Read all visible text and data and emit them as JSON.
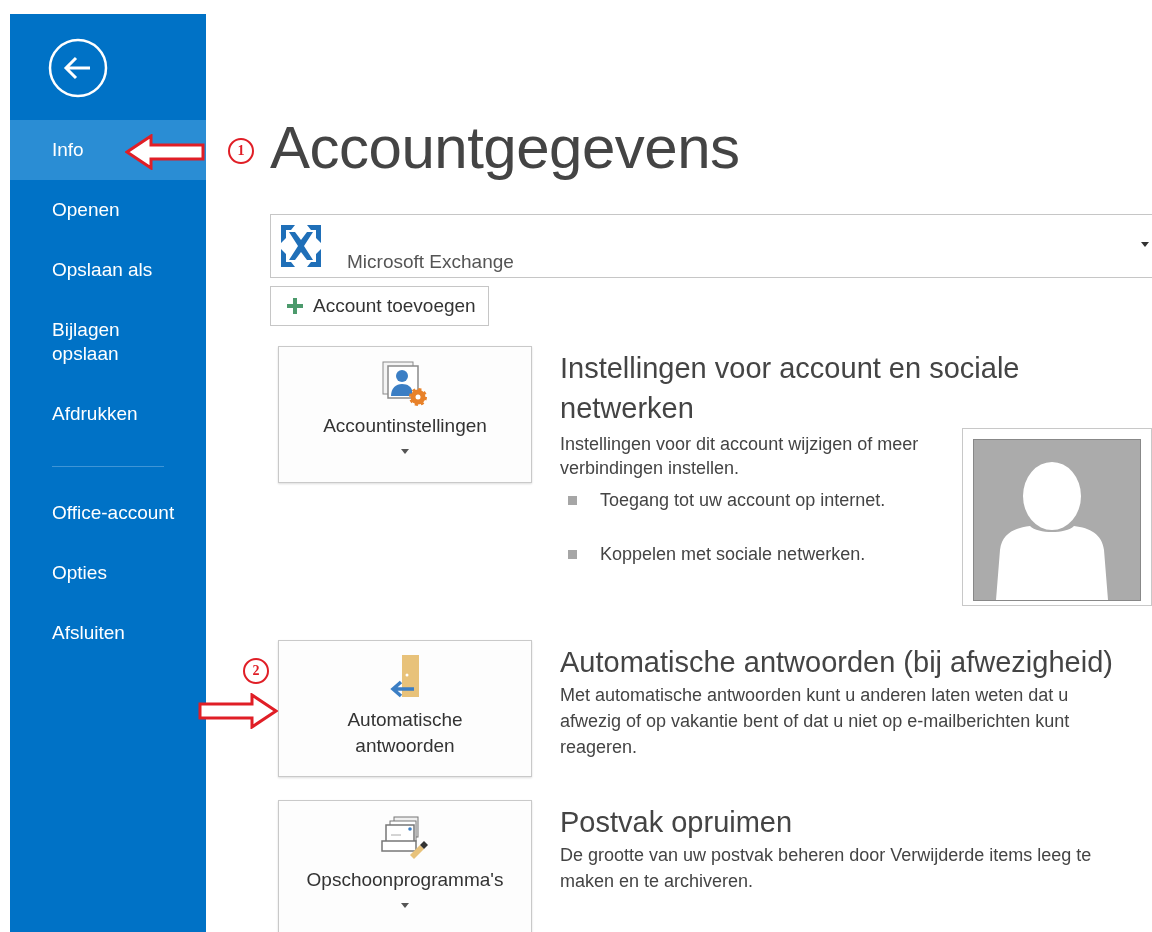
{
  "sidebar": {
    "groups": [
      {
        "items": [
          {
            "label": "Info",
            "selected": true
          },
          {
            "label": "Openen",
            "selected": false
          },
          {
            "label": "Opslaan als",
            "selected": false
          },
          {
            "label": "Bijlagen\nopslaan",
            "selected": false
          },
          {
            "label": "Afdrukken",
            "selected": false
          }
        ]
      },
      {
        "items": [
          {
            "label": "Office-account",
            "selected": false
          },
          {
            "label": "Opties",
            "selected": false
          },
          {
            "label": "Afsluiten",
            "selected": false
          }
        ]
      }
    ]
  },
  "page_title": "Accountgegevens",
  "account": {
    "name": "Microsoft Exchange"
  },
  "add_account_button": "Account toevoegen",
  "sections": [
    {
      "kind": "account-settings",
      "button": {
        "label": "Accountinstellingen",
        "dropdown": true
      },
      "title": "Instellingen voor account en sociale netwerken",
      "description": "Instellingen voor dit account wijzigen of meer verbindingen instellen.",
      "bullets": [
        "Toegang tot uw account op internet.",
        "Koppelen met sociale netwerken."
      ],
      "profile_picture": true
    },
    {
      "kind": "auto-reply",
      "button": {
        "label": "Automatische antwoorden",
        "dropdown": false
      },
      "title": "Automatische antwoorden (bij afwezigheid)",
      "description": "Met automatische antwoorden kunt u anderen laten weten dat u afwezig of op vakantie bent of dat u niet op e-mailberichten kunt reageren."
    },
    {
      "kind": "cleanup",
      "button": {
        "label": "Opschoonprogramma's",
        "dropdown": true
      },
      "title": "Postvak opruimen",
      "description": "De grootte van uw postvak beheren door Verwijderde items leeg te maken en te archiveren."
    }
  ],
  "annotations": [
    {
      "number": "1",
      "kind": "left"
    },
    {
      "number": "2",
      "kind": "right"
    }
  ]
}
